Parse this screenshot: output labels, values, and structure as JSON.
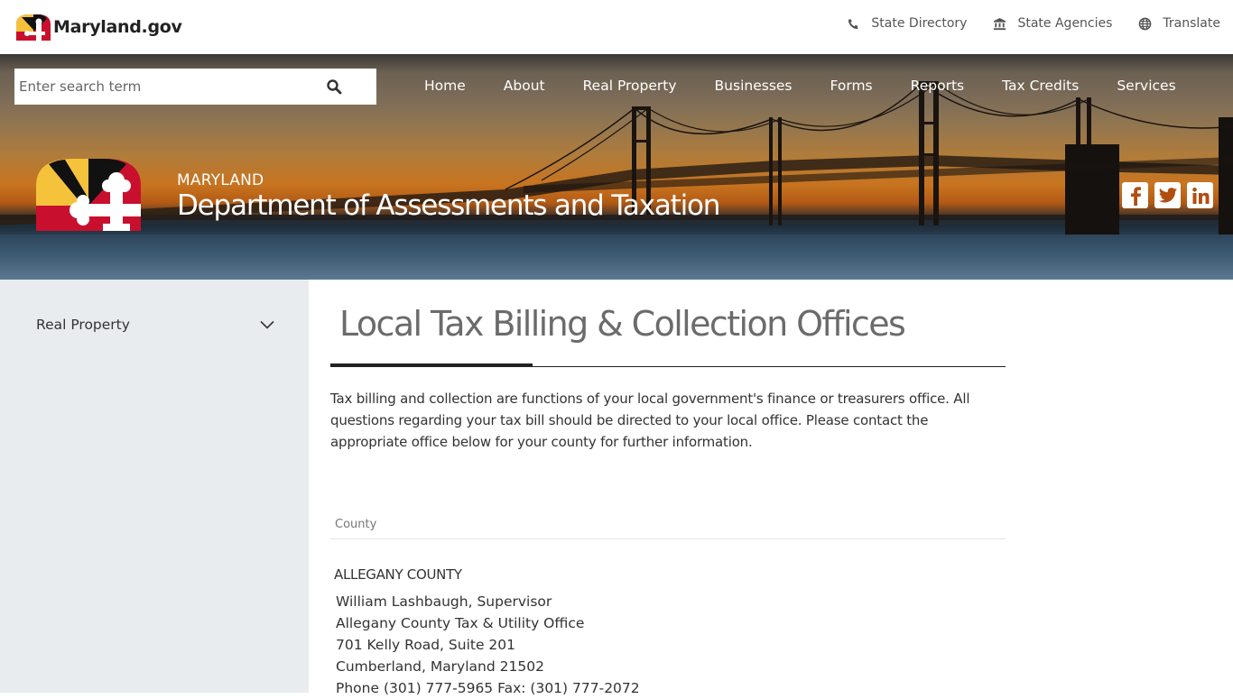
{
  "header": {
    "brand_text": "Maryland.gov",
    "utility_links": [
      {
        "label": "State Directory",
        "icon": "phone-icon"
      },
      {
        "label": "State Agencies",
        "icon": "building-columns-icon"
      },
      {
        "label": "Translate",
        "icon": "globe-icon"
      }
    ]
  },
  "search": {
    "placeholder": "Enter search term",
    "value": ""
  },
  "nav": {
    "items": [
      "Home",
      "About",
      "Real Property",
      "Businesses",
      "Forms",
      "Reports",
      "Tax Credits",
      "Services"
    ]
  },
  "agency": {
    "kicker": "MARYLAND",
    "title": "Department of Assessments and Taxation"
  },
  "social": [
    "facebook-icon",
    "twitter-icon",
    "linkedin-icon"
  ],
  "sidebar": {
    "items": [
      {
        "label": "Real Property",
        "icon": "chevron-down-icon"
      }
    ]
  },
  "main": {
    "title": "Local Tax Billing & Collection Offices",
    "intro": "Tax billing and collection are functions of your local government's finance or treasurers office. All questions regarding your tax bill should be directed to your local office. Please contact the appropriate office below for your county for further information.",
    "table": {
      "column_header": "County",
      "rows": [
        {
          "county": "ALLEGANY COUNTY",
          "lines": [
            "William Lashbaugh, Supervisor",
            "Allegany County Tax & Utility Office",
            "701 Kelly Road, Suite 201",
            "Cumberland, Maryland 21502",
            "Phone (301) 777-5965 Fax: (301) 777-2072"
          ]
        }
      ]
    }
  },
  "colors": {
    "flag_red": "#c8102e",
    "flag_gold": "#f5c33b",
    "flag_black": "#111111",
    "sidebar_bg": "#e9ecef",
    "title_text": "#6b6b6b"
  }
}
